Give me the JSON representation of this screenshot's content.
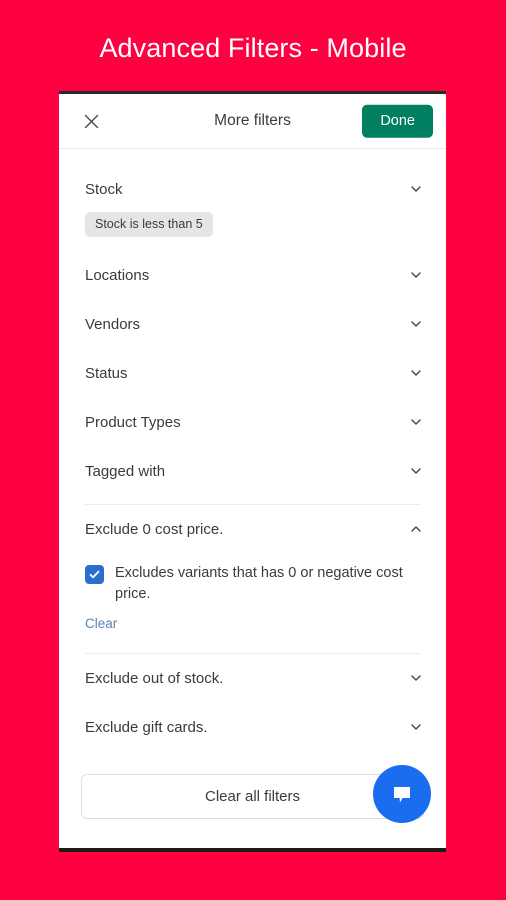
{
  "page": {
    "title": "Advanced Filters - Mobile",
    "background_color": "#ff0040"
  },
  "modal": {
    "header": {
      "close_icon": "close-icon",
      "title": "More filters",
      "done_label": "Done",
      "done_color": "#008060"
    },
    "filters": [
      {
        "label": "Stock",
        "chevron": "chevron-down-icon",
        "expanded": false,
        "chip": "Stock is less than 5"
      },
      {
        "label": "Locations",
        "chevron": "chevron-down-icon",
        "expanded": false
      },
      {
        "label": "Vendors",
        "chevron": "chevron-down-icon",
        "expanded": false
      },
      {
        "label": "Status",
        "chevron": "chevron-down-icon",
        "expanded": false
      },
      {
        "label": "Product Types",
        "chevron": "chevron-down-icon",
        "expanded": false
      },
      {
        "label": "Tagged with",
        "chevron": "chevron-down-icon",
        "expanded": false
      },
      {
        "label": "Exclude 0 cost price.",
        "chevron": "chevron-up-icon",
        "expanded": true,
        "checkbox_label": "Excludes variants that has 0 or negative cost price.",
        "checkbox_checked": true,
        "checkbox_color": "#2c6ecb",
        "clear_label": "Clear",
        "clear_color": "#5c83b5"
      },
      {
        "label": "Exclude out of stock.",
        "chevron": "chevron-down-icon",
        "expanded": false
      },
      {
        "label": "Exclude gift cards.",
        "chevron": "chevron-down-icon",
        "expanded": false
      }
    ],
    "footer": {
      "clear_all_label": "Clear all filters"
    },
    "chat": {
      "icon": "chat-bubble-icon",
      "color": "#1a6dee"
    }
  }
}
